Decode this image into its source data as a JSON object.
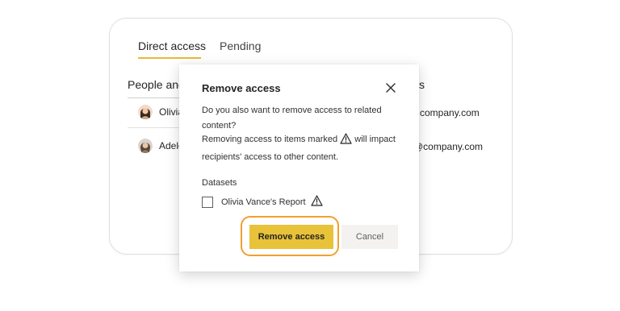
{
  "tabs": [
    {
      "label": "Direct access"
    },
    {
      "label": "Pending"
    }
  ],
  "table": {
    "left_header": "People and",
    "right_header": "ss",
    "rows": [
      {
        "name": "Olivia",
        "email": "company.com"
      },
      {
        "name": "Adele",
        "email": "@company.com"
      }
    ]
  },
  "dialog": {
    "title": "Remove access",
    "question": "Do you also want to remove access to related content?",
    "warning_before": "Removing access to items marked",
    "warning_after": "will impact recipients' access to other content.",
    "section_label": "Datasets",
    "dataset_item": "Olivia Vance's Report",
    "primary_button": "Remove access",
    "secondary_button": "Cancel"
  },
  "colors": {
    "accent": "#e8c239",
    "highlight": "#f0a030",
    "tab_underline": "#e8b83a"
  }
}
